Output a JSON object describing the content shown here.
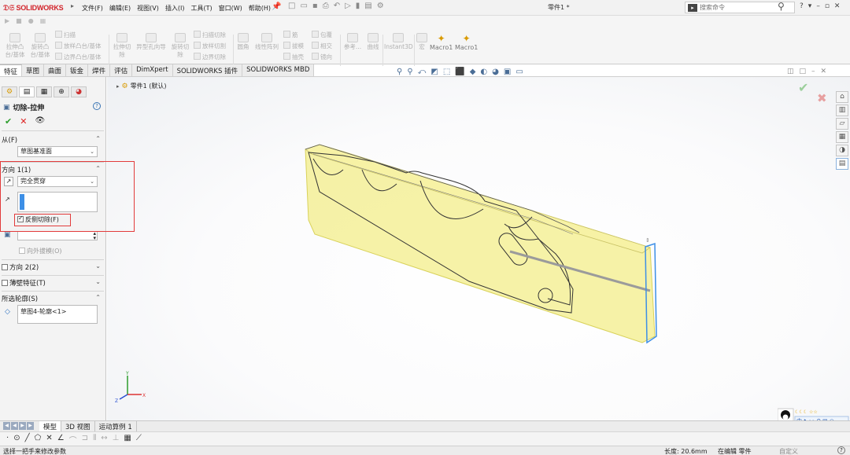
{
  "app": {
    "brand": "SOLIDWORKS",
    "document_title": "零件1 *",
    "menu": [
      "文件(F)",
      "编辑(E)",
      "视图(V)",
      "插入(I)",
      "工具(T)",
      "窗口(W)",
      "帮助(H)"
    ],
    "search_placeholder": "搜索命令"
  },
  "command_manager": {
    "tools": {
      "extrude_boss": "拉伸凸台/基体",
      "revolve_boss": "旋转凸台/基体",
      "sweep": "扫描",
      "loft": "放样凸台/基体",
      "boundary_boss": "边界凸台/基体",
      "extruded_cut": "拉伸切除",
      "hole_wizard": "异型孔向导",
      "revolved_cut": "旋转切除",
      "swept_cut": "扫描切除",
      "lofted_cut": "放样切割",
      "boundary_cut": "边界切除",
      "fillet": "圆角",
      "linear_pattern": "线性阵列",
      "rib": "筋",
      "draft": "拔模",
      "shell": "抽壳",
      "wrap": "包覆",
      "intersect": "相交",
      "mirror": "镜向",
      "reference": "参考...",
      "curves": "曲线",
      "instant3d": "Instant3D",
      "macro": "宏",
      "macro1a": "Macro1",
      "macro1b": "Macro1"
    },
    "tabs": [
      "特征",
      "草图",
      "曲面",
      "钣金",
      "焊件",
      "评估",
      "DimXpert",
      "SOLIDWORKS 插件",
      "SOLIDWORKS MBD"
    ],
    "active_tab": "特征"
  },
  "property_manager": {
    "title": "切除-拉伸",
    "from": {
      "label": "从(F)",
      "value": "草图基准面"
    },
    "direction1": {
      "label": "方向 1(1)",
      "end_condition": "完全贯穿",
      "flip_side_to_cut": "反侧切除(F)",
      "flip_checked": true,
      "draft_outward": "向外拔模(O)"
    },
    "direction2": {
      "label": "方向 2(2)"
    },
    "thin_feature": {
      "label": "薄壁特征(T)"
    },
    "selected_contours": {
      "label": "所选轮廓(S)",
      "value": "草图4-轮廓<1>"
    }
  },
  "graphics": {
    "tree_item": "零件1 (默认)",
    "triad_x": "X",
    "triad_y": "Y",
    "triad_z": "Z"
  },
  "bottom_tabs": [
    "模型",
    "3D 视图",
    "运动算例 1"
  ],
  "status": {
    "message": "选择一把手来修改参数",
    "length": "长度: 20.6mm",
    "mode": "在编辑 零件",
    "custom": "自定义",
    "help": "?"
  },
  "colors": {
    "brand_red": "#d2232a",
    "highlight_red": "#e23b3b",
    "preview_yellow": "#f3ee8a",
    "selection_blue": "#3d8fe6"
  }
}
